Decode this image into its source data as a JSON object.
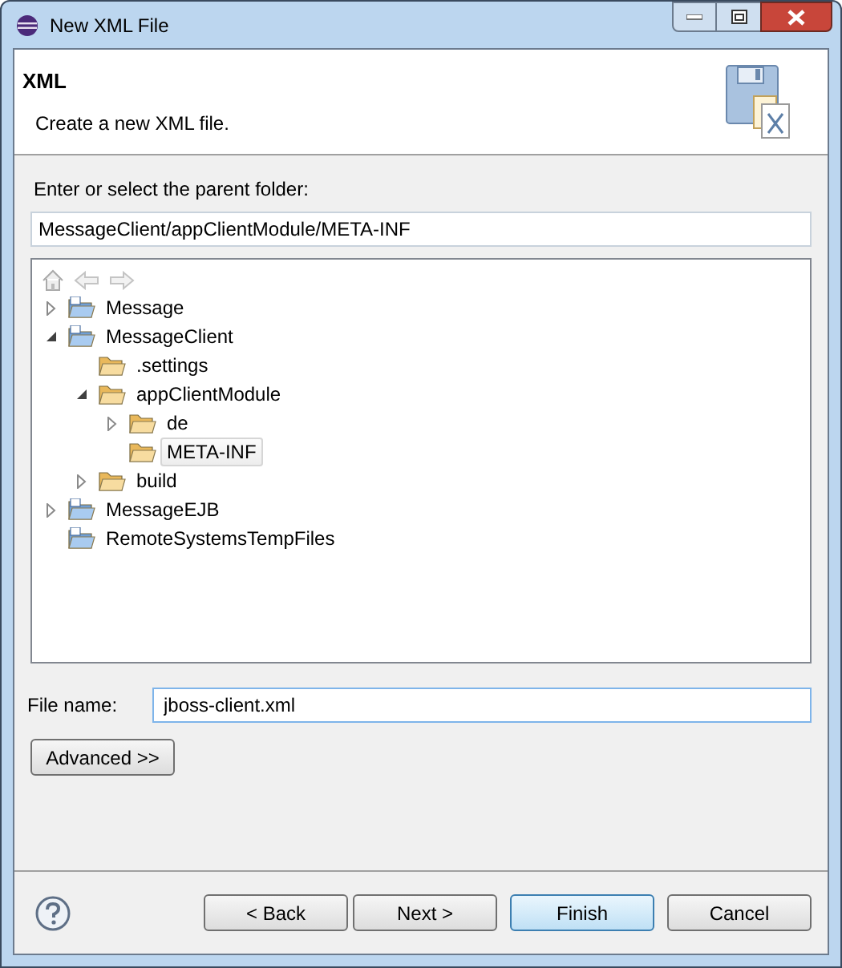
{
  "window": {
    "title": "New XML File"
  },
  "header": {
    "title": "XML",
    "description": "Create a new XML file."
  },
  "folder_label": "Enter or select the parent folder:",
  "folder_field": {
    "value": "MessageClient/appClientModule/META-INF"
  },
  "tree": [
    {
      "label": "Message",
      "kind": "project",
      "expanded": false,
      "selected": false
    },
    {
      "label": "MessageClient",
      "kind": "project",
      "expanded": true,
      "selected": false,
      "children": [
        {
          "label": ".settings",
          "kind": "folder",
          "selected": false
        },
        {
          "label": "appClientModule",
          "kind": "folder",
          "expanded": true,
          "selected": false,
          "children": [
            {
              "label": "de",
              "kind": "folder",
              "expanded": false,
              "selected": false
            },
            {
              "label": "META-INF",
              "kind": "folder",
              "selected": true
            }
          ]
        },
        {
          "label": "build",
          "kind": "folder",
          "expanded": false,
          "selected": false
        }
      ]
    },
    {
      "label": "MessageEJB",
      "kind": "project",
      "expanded": false,
      "selected": false
    },
    {
      "label": "RemoteSystemsTempFiles",
      "kind": "project",
      "selected": false
    }
  ],
  "file_name": {
    "label": "File name:",
    "value": "jboss-client.xml"
  },
  "advanced_button": "Advanced >>",
  "buttons": [
    {
      "label": "< Back",
      "default": false
    },
    {
      "label": "Next >",
      "default": false
    },
    {
      "label": "Finish",
      "default": true
    },
    {
      "label": "Cancel",
      "default": false
    }
  ]
}
